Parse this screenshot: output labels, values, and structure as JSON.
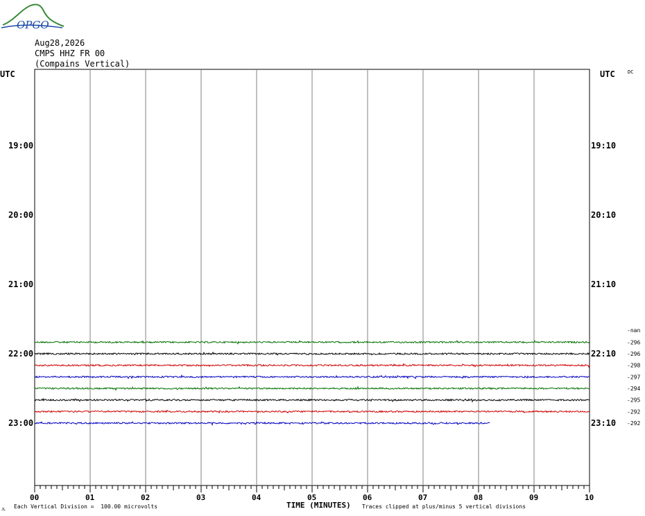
{
  "logo": {
    "text": "OPGO",
    "colors": {
      "green": "#3a8a3a",
      "blue": "#1a4aa8"
    }
  },
  "header": {
    "date": "Aug28,2026",
    "station": "CMPS HHZ FR 00",
    "location": "(Compains Vertical)"
  },
  "corner": {
    "left_label": "UTC",
    "right_label": "UTC",
    "dc_label": "DC"
  },
  "footer": {
    "scale_note": "Each Vertical Division =  100.00 microvolts",
    "axis_title": "TIME (MINUTES)",
    "clip_note": "Traces clipped at plus/minus 5 vertical divisions",
    "tiny_mark": "JL"
  },
  "chart_data": {
    "type": "line",
    "title": "",
    "xlabel": "TIME (MINUTES)",
    "x_ticks": [
      "00",
      "01",
      "02",
      "03",
      "04",
      "05",
      "06",
      "07",
      "08",
      "09",
      "10"
    ],
    "xlim": [
      0,
      10
    ],
    "left_time_labels": [
      "19:00",
      "20:00",
      "21:00",
      "22:00",
      "23:00"
    ],
    "right_time_labels": [
      "19:10",
      "20:10",
      "21:10",
      "22:10",
      "23:10"
    ],
    "dc_header": "-nan",
    "grid": true,
    "colors": [
      "#007000",
      "#000000",
      "#d00000",
      "#0000c0"
    ],
    "series": [
      {
        "row_time": "21:50",
        "offset": "-296",
        "color": "#007000",
        "x_end": 10
      },
      {
        "row_time": "22:00",
        "offset": "-296",
        "color": "#000000",
        "x_end": 10
      },
      {
        "row_time": "22:10",
        "offset": "-298",
        "color": "#d00000",
        "x_end": 10
      },
      {
        "row_time": "22:20",
        "offset": "-297",
        "color": "#0000c0",
        "x_end": 10
      },
      {
        "row_time": "22:30",
        "offset": "-294",
        "color": "#007000",
        "x_end": 10
      },
      {
        "row_time": "22:40",
        "offset": "-295",
        "color": "#000000",
        "x_end": 10
      },
      {
        "row_time": "22:50",
        "offset": "-292",
        "color": "#d00000",
        "x_end": 10
      },
      {
        "row_time": "23:00",
        "offset": "-292",
        "color": "#0000c0",
        "x_end": 8.2
      }
    ]
  }
}
